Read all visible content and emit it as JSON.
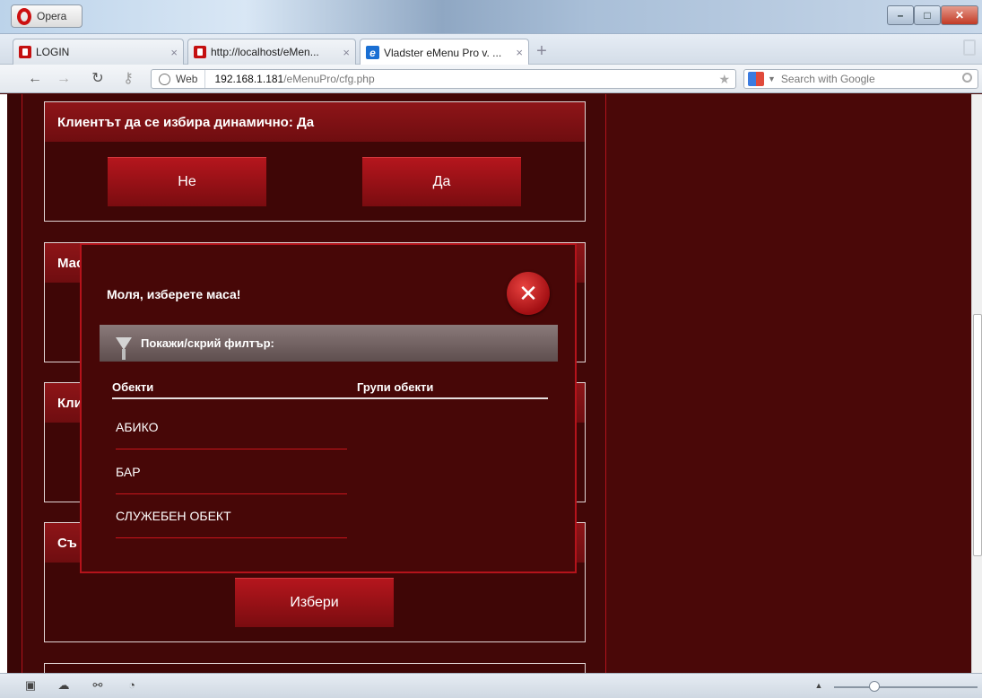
{
  "browser": {
    "menu_label": "Opera",
    "window_controls": {
      "minimize": "–",
      "maximize": "□",
      "close": "✕"
    },
    "tabs": [
      {
        "label": "LOGIN",
        "icon": "opera-page-icon"
      },
      {
        "label": "http://localhost/eMen...",
        "icon": "opera-page-icon"
      },
      {
        "label": "Vladster eMenu Pro v. ...",
        "icon": "ie-page-icon"
      }
    ],
    "tab_close": "×",
    "new_tab": "+",
    "address": {
      "web_label": "Web",
      "host": "192.168.1.181",
      "path": "/eMenuPro/cfg.php"
    },
    "search_placeholder": "Search with Google"
  },
  "page": {
    "panels": [
      {
        "title": "Клиентът да се избира динамично: Да",
        "buttons": [
          "Не",
          "Да"
        ]
      },
      {
        "title": "Мас"
      },
      {
        "title": "Кли"
      },
      {
        "title": "Съ",
        "button": "Избери"
      }
    ]
  },
  "modal": {
    "title": "Моля, изберете маса!",
    "close_symbol": "✕",
    "filter_label": "Покажи/скрий филтър:",
    "columns": [
      "Обекти",
      "Групи обекти"
    ],
    "items": [
      "АБИКО",
      "БАР",
      "СЛУЖЕБЕН ОБЕКТ"
    ]
  },
  "colors": {
    "page_bg": "#4a0808",
    "accent_red": "#b5131b",
    "button_red": "#9a1117",
    "filter_bar": "#6e5e5e"
  }
}
